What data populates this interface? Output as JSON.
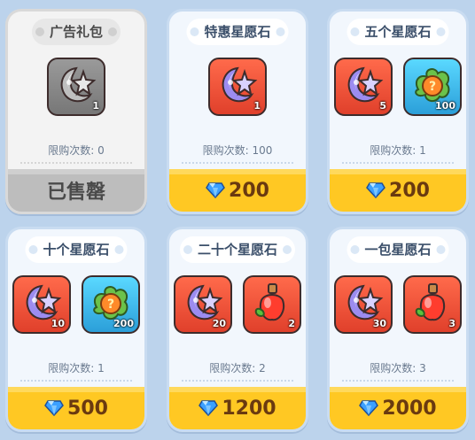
{
  "limit_label": "限购次数: ",
  "cards": [
    {
      "title": "广告礼包",
      "sold_out": true,
      "items": [
        {
          "kind": "wish-stone",
          "color": "gray",
          "qty": "1"
        }
      ],
      "limit": "0",
      "button": "已售罄"
    },
    {
      "title": "特惠星愿石",
      "sold_out": false,
      "items": [
        {
          "kind": "wish-stone",
          "color": "red",
          "qty": "1"
        }
      ],
      "limit": "100",
      "button": "200"
    },
    {
      "title": "五个星愿石",
      "sold_out": false,
      "items": [
        {
          "kind": "wish-stone",
          "color": "red",
          "qty": "5"
        },
        {
          "kind": "mystery-seed",
          "color": "blue",
          "qty": "100"
        }
      ],
      "limit": "1",
      "button": "200"
    },
    {
      "title": "十个星愿石",
      "sold_out": false,
      "items": [
        {
          "kind": "wish-stone",
          "color": "red",
          "qty": "10"
        },
        {
          "kind": "mystery-seed",
          "color": "blue",
          "qty": "200"
        }
      ],
      "limit": "1",
      "button": "500"
    },
    {
      "title": "二十个星愿石",
      "sold_out": false,
      "items": [
        {
          "kind": "wish-stone",
          "color": "red",
          "qty": "20"
        },
        {
          "kind": "apple-potion",
          "color": "red",
          "qty": "2"
        }
      ],
      "limit": "2",
      "button": "1200"
    },
    {
      "title": "一包星愿石",
      "sold_out": false,
      "items": [
        {
          "kind": "wish-stone",
          "color": "red",
          "qty": "30"
        },
        {
          "kind": "apple-potion",
          "color": "red",
          "qty": "3"
        }
      ],
      "limit": "3",
      "button": "2000"
    }
  ],
  "colors": {
    "background": "#bcd3ec",
    "button_gold": "#ffc823",
    "price_text": "#6a3a10",
    "item_red": "#f0553a",
    "item_blue": "#3ab8ec"
  }
}
